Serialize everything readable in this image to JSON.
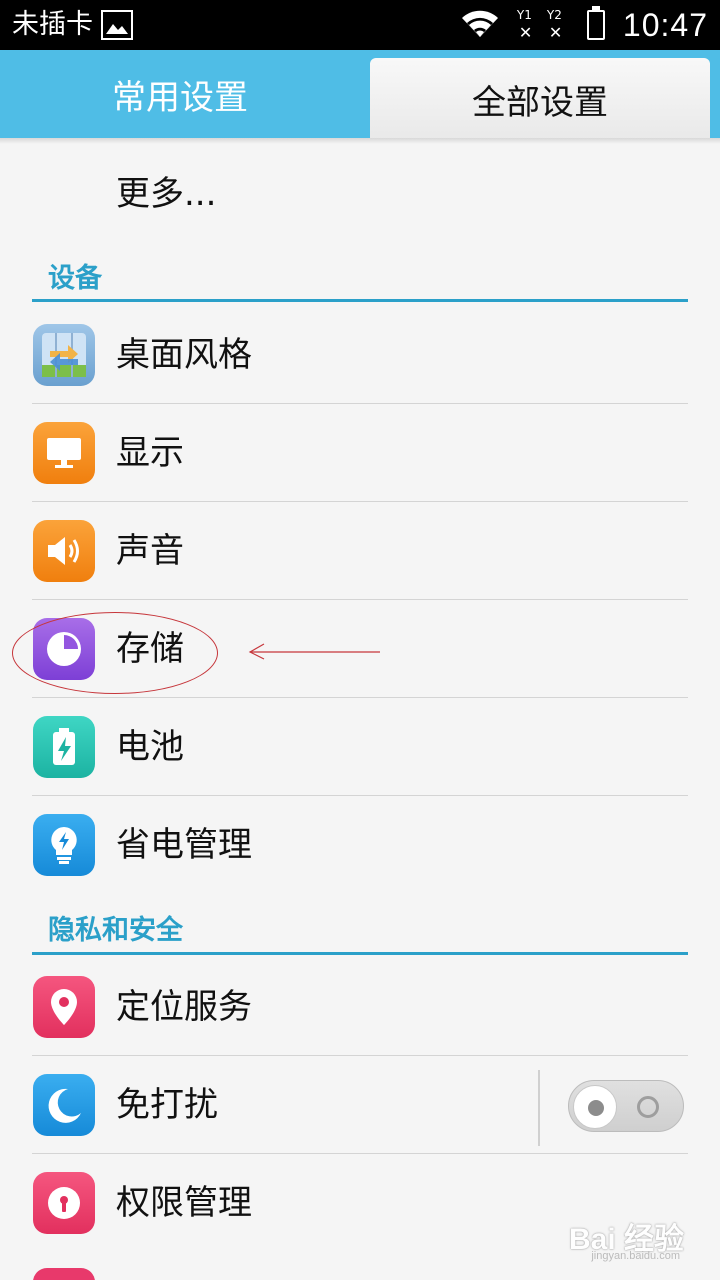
{
  "status_bar": {
    "carrier": "未插卡",
    "sim1": "Y1",
    "sim2": "Y2",
    "time": "10:47"
  },
  "tabs": {
    "common": "常用设置",
    "all": "全部设置"
  },
  "list": {
    "more": "更多...",
    "section_device": "设备",
    "desktop_style": "桌面风格",
    "display": "显示",
    "sound": "声音",
    "storage": "存储",
    "battery": "电池",
    "power_mgmt": "省电管理",
    "section_privacy": "隐私和安全",
    "location": "定位服务",
    "dnd": "免打扰",
    "permission": "权限管理"
  },
  "dnd_toggle": {
    "on": false
  },
  "watermark": {
    "text": "Bai 经验",
    "sub": "jingyan.baidu.com"
  },
  "colors": {
    "accent": "#2ba0c9",
    "tab_bar": "#4fbde6",
    "annotation": "#c6363b"
  }
}
